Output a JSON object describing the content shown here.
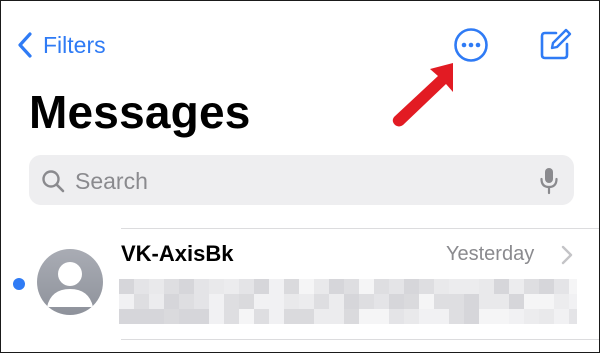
{
  "nav": {
    "back_label": "Filters",
    "back_icon": "chevron-left-icon",
    "more_icon": "ellipsis-circle-icon",
    "compose_icon": "compose-icon",
    "annotation_icon": "red-arrow-icon"
  },
  "title": "Messages",
  "search": {
    "placeholder": "Search",
    "search_icon": "magnifier-icon",
    "mic_icon": "microphone-icon"
  },
  "conversations": [
    {
      "sender": "VK-AxisBk",
      "time": "Yesterday",
      "unread": true,
      "preview_pixelated": true
    }
  ],
  "colors": {
    "accent": "#2f7bf5",
    "annotation_red": "#e21b23",
    "search_bg": "#eeeef0",
    "secondary_text": "#8a8a8e"
  }
}
